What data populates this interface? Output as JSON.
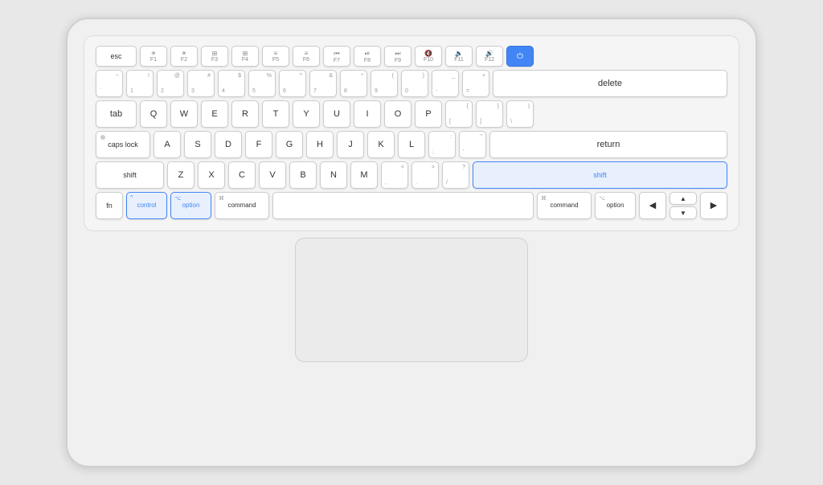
{
  "keyboard": {
    "rows": {
      "fn": {
        "keys": [
          {
            "id": "esc",
            "label": "esc",
            "width": "w15"
          },
          {
            "id": "f1",
            "top": "✦",
            "bottom": "F1",
            "width": "w1",
            "icon": "☀"
          },
          {
            "id": "f2",
            "top": "✦",
            "bottom": "F2",
            "width": "w1",
            "icon": "☀"
          },
          {
            "id": "f3",
            "top": "⊞",
            "bottom": "F3",
            "width": "w1"
          },
          {
            "id": "f4",
            "top": "⊞⊞",
            "bottom": "F4",
            "width": "w1"
          },
          {
            "id": "f5",
            "top": "≡",
            "bottom": "F5",
            "width": "w1"
          },
          {
            "id": "f6",
            "top": "≡",
            "bottom": "F6",
            "width": "w1"
          },
          {
            "id": "f7",
            "top": "◀◀",
            "bottom": "F7",
            "width": "w1"
          },
          {
            "id": "f8",
            "top": "▶⏸",
            "bottom": "F8",
            "width": "w1"
          },
          {
            "id": "f9",
            "top": "▶▶",
            "bottom": "F9",
            "width": "w1"
          },
          {
            "id": "f10",
            "top": "🔇",
            "bottom": "F10",
            "width": "w1"
          },
          {
            "id": "f11",
            "top": "🔉",
            "bottom": "F11",
            "width": "w1"
          },
          {
            "id": "f12",
            "top": "🔊",
            "bottom": "F12",
            "width": "w1"
          },
          {
            "id": "power",
            "label": "",
            "width": "w1",
            "highlight": "power"
          }
        ]
      },
      "row1": {
        "keys": [
          {
            "id": "tilde",
            "top": "~",
            "bottom": "`",
            "width": "w1"
          },
          {
            "id": "1",
            "top": "!",
            "bottom": "1",
            "width": "w1"
          },
          {
            "id": "2",
            "top": "@",
            "bottom": "2",
            "width": "w1"
          },
          {
            "id": "3",
            "top": "#",
            "bottom": "3",
            "width": "w1"
          },
          {
            "id": "4",
            "top": "$",
            "bottom": "4",
            "width": "w1"
          },
          {
            "id": "5",
            "top": "%",
            "bottom": "5",
            "width": "w1"
          },
          {
            "id": "6",
            "top": "^",
            "bottom": "6",
            "width": "w1"
          },
          {
            "id": "7",
            "top": "&",
            "bottom": "7",
            "width": "w1"
          },
          {
            "id": "8",
            "top": "*",
            "bottom": "8",
            "width": "w1"
          },
          {
            "id": "9",
            "top": "(",
            "bottom": "9",
            "width": "w1"
          },
          {
            "id": "0",
            "top": ")",
            "bottom": "0",
            "width": "w1"
          },
          {
            "id": "minus",
            "top": "_",
            "bottom": "-",
            "width": "w1"
          },
          {
            "id": "equals",
            "top": "+",
            "bottom": "=",
            "width": "w1"
          },
          {
            "id": "delete",
            "label": "delete",
            "width": "wflex"
          }
        ]
      },
      "row2": {
        "keys": [
          {
            "id": "tab",
            "label": "tab",
            "width": "w15"
          },
          {
            "id": "q",
            "label": "Q",
            "width": "w1"
          },
          {
            "id": "w",
            "label": "W",
            "width": "w1"
          },
          {
            "id": "e",
            "label": "E",
            "width": "w1"
          },
          {
            "id": "r",
            "label": "R",
            "width": "w1"
          },
          {
            "id": "t",
            "label": "T",
            "width": "w1"
          },
          {
            "id": "y",
            "label": "Y",
            "width": "w1"
          },
          {
            "id": "u",
            "label": "U",
            "width": "w1"
          },
          {
            "id": "i",
            "label": "I",
            "width": "w1"
          },
          {
            "id": "o",
            "label": "O",
            "width": "w1"
          },
          {
            "id": "p",
            "label": "P",
            "width": "w1"
          },
          {
            "id": "bracketl",
            "top": "{",
            "bottom": "[",
            "width": "w1"
          },
          {
            "id": "bracketr",
            "top": "}",
            "bottom": "]",
            "width": "w1"
          },
          {
            "id": "backslash",
            "top": "|",
            "bottom": "\\",
            "width": "w1"
          }
        ]
      },
      "row3": {
        "keys": [
          {
            "id": "capslock",
            "label": "caps lock",
            "top_dot": true,
            "width": "w2"
          },
          {
            "id": "a",
            "label": "A",
            "width": "w1"
          },
          {
            "id": "s",
            "label": "S",
            "width": "w1"
          },
          {
            "id": "d",
            "label": "D",
            "width": "w1"
          },
          {
            "id": "f",
            "label": "F",
            "width": "w1"
          },
          {
            "id": "g",
            "label": "G",
            "width": "w1"
          },
          {
            "id": "h",
            "label": "H",
            "width": "w1"
          },
          {
            "id": "j",
            "label": "J",
            "width": "w1"
          },
          {
            "id": "k",
            "label": "K",
            "width": "w1"
          },
          {
            "id": "l",
            "label": "L",
            "width": "w1"
          },
          {
            "id": "semicolon",
            "top": ":",
            "bottom": ";",
            "width": "w1"
          },
          {
            "id": "quote",
            "top": "\"",
            "bottom": "'",
            "width": "w1"
          },
          {
            "id": "return",
            "label": "return",
            "width": "wflex"
          }
        ]
      },
      "row4": {
        "keys": [
          {
            "id": "shift-l",
            "label": "shift",
            "width": "w25"
          },
          {
            "id": "z",
            "label": "Z",
            "width": "w1"
          },
          {
            "id": "x",
            "label": "X",
            "width": "w1"
          },
          {
            "id": "c",
            "label": "C",
            "width": "w1"
          },
          {
            "id": "v",
            "label": "V",
            "width": "w1"
          },
          {
            "id": "b",
            "label": "B",
            "width": "w1"
          },
          {
            "id": "n",
            "label": "N",
            "width": "w1"
          },
          {
            "id": "m",
            "label": "M",
            "width": "w1"
          },
          {
            "id": "comma",
            "top": "<",
            "bottom": ",",
            "width": "w1"
          },
          {
            "id": "period",
            "top": ">",
            "bottom": ".",
            "width": "w1"
          },
          {
            "id": "slash",
            "top": "?",
            "bottom": "/",
            "width": "w1"
          },
          {
            "id": "shift-r",
            "label": "shift",
            "width": "wflex",
            "highlight": "shift"
          }
        ]
      },
      "row5": {
        "keys": [
          {
            "id": "fn",
            "label": "fn",
            "width": "w1"
          },
          {
            "id": "control",
            "label": "control",
            "icon_top": "^",
            "width": "w15",
            "highlight": "blue"
          },
          {
            "id": "option-l",
            "label": "option",
            "icon_top": "⌥",
            "width": "w15",
            "highlight": "blue"
          },
          {
            "id": "command-l",
            "label": "command",
            "icon_top": "⌘",
            "width": "w2"
          },
          {
            "id": "space",
            "label": "",
            "width": "wflex"
          },
          {
            "id": "command-r",
            "label": "command",
            "icon_top": "⌘",
            "width": "w2"
          },
          {
            "id": "option-r",
            "label": "option",
            "icon_top": "⌥",
            "width": "w15"
          },
          {
            "id": "arrow-left",
            "label": "◀",
            "width": "w1"
          },
          {
            "id": "arrow-up-down",
            "label": "▲▼",
            "width": "w1"
          },
          {
            "id": "arrow-right",
            "label": "▶",
            "width": "w1"
          }
        ]
      }
    }
  }
}
